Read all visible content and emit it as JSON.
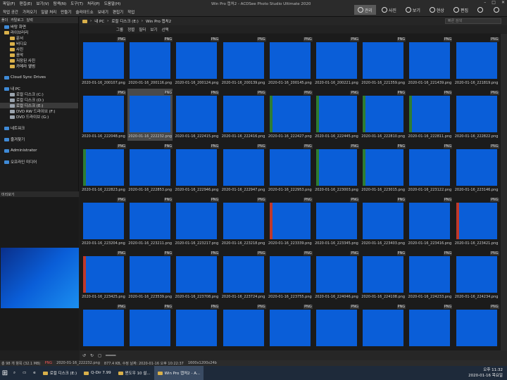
{
  "window": {
    "title": "Win Pro 캡처2 - ACDSee Photo Studio Ultimate 2020",
    "menu": [
      "파일(F)",
      "편집(E)",
      "보기(V)",
      "탐색(N)",
      "도구(T)",
      "처리(P)",
      "도움말(H)"
    ]
  },
  "toolbar": {
    "items": [
      "작업 공간",
      "가져오기",
      "일괄 처리",
      "만들기",
      "슬라이드쇼",
      "보내기",
      "편집기",
      "작업"
    ]
  },
  "modes": [
    {
      "label": "관리",
      "active": true
    },
    {
      "label": "사진",
      "active": false
    },
    {
      "label": "보기",
      "active": false
    },
    {
      "label": "현상",
      "active": false
    },
    {
      "label": "편집",
      "active": false
    },
    {
      "label": "",
      "active": false
    },
    {
      "label": "",
      "active": false
    }
  ],
  "left_panel": {
    "tabs": [
      "폴더",
      "카탈로그",
      "달력"
    ],
    "tree": [
      {
        "label": "바탕 화면",
        "icon": "blue"
      },
      {
        "label": "라이브러리",
        "icon": "folder"
      },
      {
        "label": "문서",
        "icon": "folder"
      },
      {
        "label": "비디오",
        "icon": "folder"
      },
      {
        "label": "사진",
        "icon": "folder"
      },
      {
        "label": "음악",
        "icon": "folder"
      },
      {
        "label": "저장된 사진",
        "icon": "folder"
      },
      {
        "label": "카메라 앨범",
        "icon": "folder"
      },
      {
        "label": "",
        "icon": ""
      },
      {
        "label": "Cloud Sync Drives",
        "icon": "blue"
      },
      {
        "label": "",
        "icon": ""
      },
      {
        "label": "내 PC",
        "icon": "blue"
      },
      {
        "label": "로컬 디스크 (C:)",
        "icon": "drive"
      },
      {
        "label": "로컬 디스크 (D:)",
        "icon": "drive"
      },
      {
        "label": "로컬 디스크 (E:)",
        "icon": "drive"
      },
      {
        "label": "DVD RW 드라이브 (F:)",
        "icon": "drive"
      },
      {
        "label": "DVD 드라이브 (G:)",
        "icon": "drive"
      },
      {
        "label": "",
        "icon": ""
      },
      {
        "label": "네트워크",
        "icon": "blue"
      },
      {
        "label": "",
        "icon": ""
      },
      {
        "label": "즐겨찾기",
        "icon": "blue"
      },
      {
        "label": "",
        "icon": ""
      },
      {
        "label": "Administrator",
        "icon": "blue"
      },
      {
        "label": "",
        "icon": ""
      },
      {
        "label": "오프라인 미디어",
        "icon": "blue"
      }
    ],
    "preview_label": "미리보기"
  },
  "path": {
    "crumbs": [
      "내 PC",
      "로컬 디스크 (E:)",
      "Win Pro 캡처2"
    ],
    "search_placeholder": "빠른 검색"
  },
  "subbar": [
    "그룹",
    "정렬",
    "필터",
    "보기",
    "선택"
  ],
  "grid": {
    "badge": "PNG",
    "items": [
      {
        "name": "2020-01-16_200107.png",
        "type": "win"
      },
      {
        "name": "2020-01-16_200116.png",
        "type": "win"
      },
      {
        "name": "2020-01-16_200124.png",
        "type": "dark"
      },
      {
        "name": "2020-01-16_200139.png",
        "type": "win"
      },
      {
        "name": "2020-01-16_200145.png",
        "type": "win"
      },
      {
        "name": "2020-01-16_200221.png",
        "type": "white"
      },
      {
        "name": "2020-01-16_221359.png",
        "type": "win"
      },
      {
        "name": "2020-01-16_221439.png",
        "type": "white"
      },
      {
        "name": "2020-01-16_221819.png",
        "type": "win"
      },
      {
        "name": "2020-01-16_222048.png",
        "type": "win"
      },
      {
        "name": "2020-01-16_222232.png",
        "type": "win",
        "selected": true
      },
      {
        "name": "2020-01-16_222415.png",
        "type": "white"
      },
      {
        "name": "2020-01-16_222416.png",
        "type": "white"
      },
      {
        "name": "2020-01-16_222427.png",
        "type": "green"
      },
      {
        "name": "2020-01-16_222445.png",
        "type": "green"
      },
      {
        "name": "2020-01-16_222810.png",
        "type": "green"
      },
      {
        "name": "2020-01-16_222811.png",
        "type": "green"
      },
      {
        "name": "2020-01-16_222822.png",
        "type": "white"
      },
      {
        "name": "2020-01-16_222823.png",
        "type": "green"
      },
      {
        "name": "2020-01-16_222853.png",
        "type": "white"
      },
      {
        "name": "2020-01-16_222946.png",
        "type": "white"
      },
      {
        "name": "2020-01-16_222947.png",
        "type": "white"
      },
      {
        "name": "2020-01-16_222953.png",
        "type": "white"
      },
      {
        "name": "2020-01-16_223003.png",
        "type": "green"
      },
      {
        "name": "2020-01-16_223015.png",
        "type": "green"
      },
      {
        "name": "2020-01-16_223122.png",
        "type": "white"
      },
      {
        "name": "2020-01-16_223146.png",
        "type": "white"
      },
      {
        "name": "2020-01-16_223204.png",
        "type": "white"
      },
      {
        "name": "2020-01-16_223211.png",
        "type": "white"
      },
      {
        "name": "2020-01-16_223217.png",
        "type": "white"
      },
      {
        "name": "2020-01-16_223218.png",
        "type": "white"
      },
      {
        "name": "2020-01-16_223339.png",
        "type": "red"
      },
      {
        "name": "2020-01-16_223345.png",
        "type": "white"
      },
      {
        "name": "2020-01-16_223403.png",
        "type": "ppt"
      },
      {
        "name": "2020-01-16_223416.png",
        "type": "ppt"
      },
      {
        "name": "2020-01-16_223421.png",
        "type": "red"
      },
      {
        "name": "2020-01-16_223425.png",
        "type": "red"
      },
      {
        "name": "2020-01-16_223539.png",
        "type": "win"
      },
      {
        "name": "2020-01-16_223708.png",
        "type": "win"
      },
      {
        "name": "2020-01-16_223724.png",
        "type": "win"
      },
      {
        "name": "2020-01-16_223755.png",
        "type": "win"
      },
      {
        "name": "2020-01-16_224046.png",
        "type": "win"
      },
      {
        "name": "2020-01-16_224108.png",
        "type": "win"
      },
      {
        "name": "2020-01-16_224233.png",
        "type": "win"
      },
      {
        "name": "2020-01-16_224234.png",
        "type": "win"
      },
      {
        "name": "",
        "type": "win"
      },
      {
        "name": "",
        "type": "win"
      },
      {
        "name": "",
        "type": "win"
      },
      {
        "name": "",
        "type": "white"
      },
      {
        "name": "",
        "type": "white"
      },
      {
        "name": "",
        "type": "white"
      },
      {
        "name": "",
        "type": "white"
      },
      {
        "name": "",
        "type": "win"
      },
      {
        "name": "",
        "type": "win"
      }
    ]
  },
  "status": {
    "total": "총 98 개 항목 (32.1 MB)",
    "format": "PNG",
    "file": "2020-01-16_222232.png",
    "size": "877.4 KB, 수정 날짜: 2020-01-16 오후 10:22:37",
    "dims": "1600x1200x24b"
  },
  "taskbar": {
    "items": [
      {
        "label": "로컬 디스크 (E:)",
        "active": false
      },
      {
        "label": "Q-Dir 7.99",
        "active": false
      },
      {
        "label": "윈도우 10 설...",
        "active": false
      },
      {
        "label": "Win Pro 캡처2 - A...",
        "active": true
      }
    ],
    "time": "오후 11:32",
    "date": "2020-01-16 목요일"
  }
}
